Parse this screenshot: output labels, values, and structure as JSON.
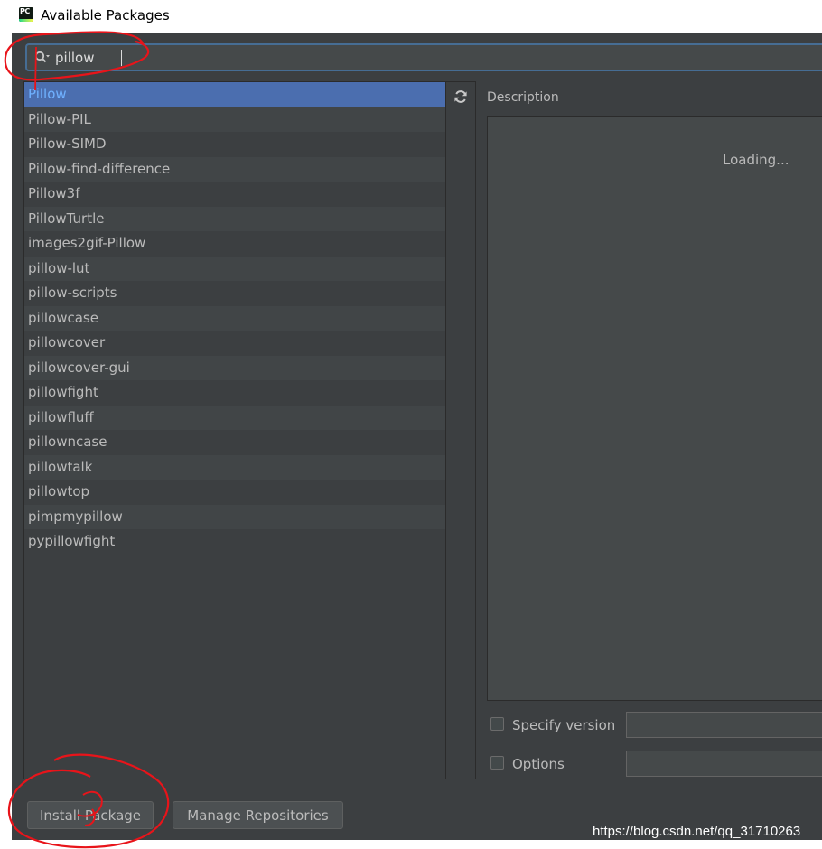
{
  "window": {
    "title": "Available Packages",
    "app_icon_text": "PC"
  },
  "search": {
    "value": "pillow"
  },
  "packages": [
    "Pillow",
    "Pillow-PIL",
    "Pillow-SIMD",
    "Pillow-find-difference",
    "Pillow3f",
    "PillowTurtle",
    "images2gif-Pillow",
    "pillow-lut",
    "pillow-scripts",
    "pillowcase",
    "pillowcover",
    "pillowcover-gui",
    "pillowfight",
    "pillowfluff",
    "pillowncase",
    "pillowtalk",
    "pillowtop",
    "pimpmypillow",
    "pypillowfight"
  ],
  "selected_index": 0,
  "description": {
    "label": "Description",
    "status": "Loading..."
  },
  "options": {
    "specify_version_label": "Specify version",
    "options_label": "Options",
    "specify_version_checked": false,
    "options_checked": false
  },
  "buttons": {
    "install": "Install Package",
    "manage_repos": "Manage Repositories"
  },
  "watermark": "https://blog.csdn.net/qq_31710263",
  "colors": {
    "background": "#3c3f41",
    "selection": "#4b6eaf",
    "selected_text": "#6fb1ff",
    "text": "#bbbbbb",
    "annotation": "#e8141a"
  }
}
